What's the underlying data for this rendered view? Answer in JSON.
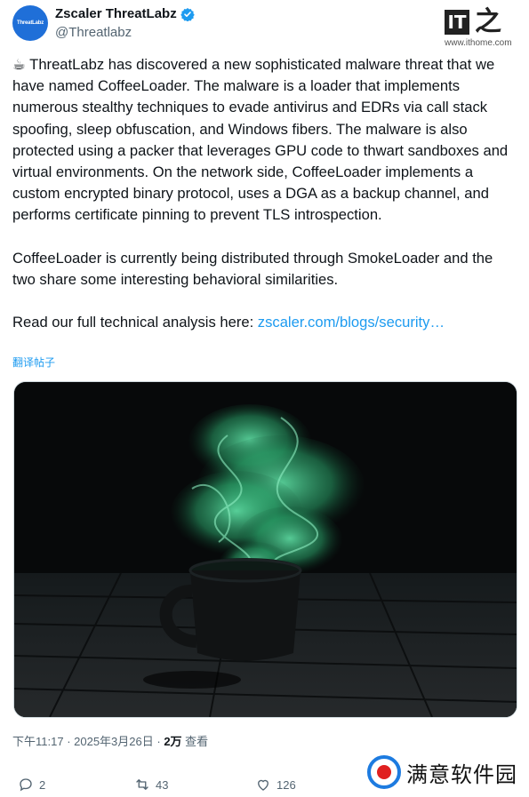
{
  "account": {
    "avatar_text": "ThreatLabz",
    "name": "Zscaler ThreatLabz",
    "handle": "@Threatlabz",
    "verified_icon": "verified-badge-icon"
  },
  "watermark_top": {
    "logo_text": "IT",
    "logo_char": "之",
    "url": "www.ithome.com"
  },
  "post": {
    "paragraph1": "☕ ThreatLabz has discovered a new sophisticated malware threat that we have named CoffeeLoader. The malware is a loader that implements numerous stealthy techniques to evade antivirus and EDRs via call stack spoofing, sleep obfuscation, and Windows fibers. The malware is also protected using a packer that leverages GPU code to thwart sandboxes and virtual environments. On the network side, CoffeeLoader implements a custom encrypted binary protocol, uses a DGA as a backup channel, and performs certificate pinning to prevent TLS introspection.",
    "paragraph2": "CoffeeLoader is currently being distributed through SmokeLoader and the two share some interesting behavioral similarities.",
    "paragraph3_prefix": "Read our full technical analysis here: ",
    "link_text": "zscaler.com/blogs/security…",
    "translate_label": "翻译帖子"
  },
  "meta": {
    "time": "下午11:17",
    "sep1": " · ",
    "date": "2025年3月26日",
    "sep2": " · ",
    "views_count": "2万",
    "views_label": " 查看"
  },
  "actions": {
    "replies": "2",
    "reposts": "43",
    "likes": "126"
  },
  "watermark_bottom": {
    "text": "满意软件园"
  },
  "colors": {
    "link": "#1d9bf0",
    "secondary_text": "#536471",
    "smoke": "#3fd18a"
  }
}
